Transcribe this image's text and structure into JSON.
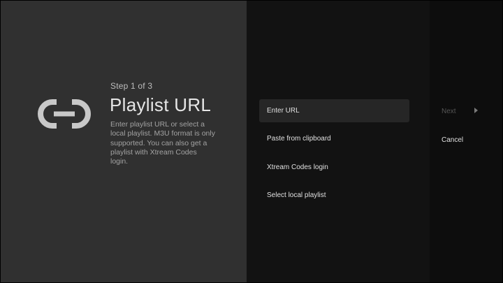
{
  "guidance": {
    "icon": "link-icon",
    "breadcrumb": "Step 1 of 3",
    "title": "Playlist URL",
    "description": "Enter playlist URL or select a local playlist. M3U format is only supported. You can also get a playlist with Xtream Codes login."
  },
  "actions": [
    {
      "label": "Enter URL",
      "focused": true
    },
    {
      "label": "Paste from clipboard",
      "focused": false
    },
    {
      "label": "Xtream Codes login",
      "focused": false
    },
    {
      "label": "Select local playlist",
      "focused": false
    }
  ],
  "buttons": {
    "next": {
      "label": "Next",
      "icon": "chevron-right-icon",
      "enabled": false
    },
    "cancel": {
      "label": "Cancel",
      "enabled": true
    }
  },
  "colors": {
    "guidance_bg": "#303030",
    "actions_bg": "#121212",
    "buttons_bg": "#0d0d0d",
    "focus_bg": "#262626"
  }
}
